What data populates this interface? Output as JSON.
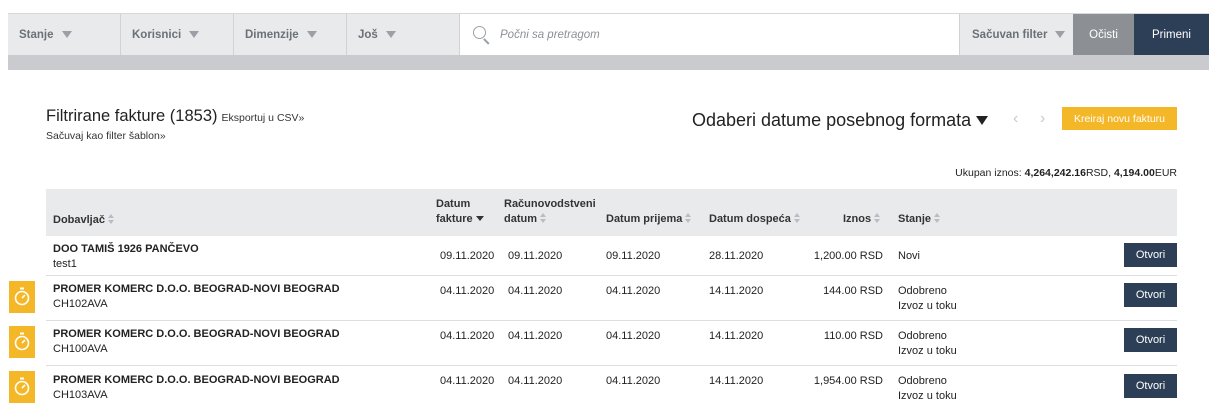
{
  "filterbar": {
    "dropdowns": [
      {
        "label": "Stanje"
      },
      {
        "label": "Korisnici"
      },
      {
        "label": "Dimenzije"
      },
      {
        "label": "Još"
      }
    ],
    "search_placeholder": "Počni sa pretragom",
    "saved_filter": "Sačuvan filter",
    "clear_label": "Očisti",
    "apply_label": "Primeni"
  },
  "header": {
    "title": "Filtrirane fakture (1853)",
    "export_label": "Eksportuj u CSV»",
    "save_filter_label": "Sačuvaj kao filter šablon»",
    "date_picker_label": "Odaberi datume posebnog formata",
    "prev_arrow": "‹",
    "next_arrow": "›",
    "create_label": "Kreiraj novu fakturu"
  },
  "totals": {
    "label": "Ukupan iznos:",
    "rsd_amount": "4,264,242.16",
    "rsd_unit": "RSD,",
    "eur_amount": "4,194.00",
    "eur_unit": "EUR"
  },
  "table": {
    "columns": {
      "supplier": "Dobavljač",
      "invoice_date_1": "Datum",
      "invoice_date_2": "fakture",
      "accounting_date_1": "Računovodstveni",
      "accounting_date_2": "datum",
      "received_date": "Datum prijema",
      "due_date": "Datum dospeća",
      "amount": "Iznos",
      "status": "Stanje"
    },
    "rows": [
      {
        "supplier": "DOO TAMIŠ 1926 PANČEVO",
        "code": "test1",
        "invoice_date": "09.11.2020",
        "accounting_date": "09.11.2020",
        "received_date": "09.11.2020",
        "due_date": "28.11.2020",
        "amount": "1,200.00 RSD",
        "status": "Novi",
        "status2": "",
        "action": "Otvori",
        "timer_icon": ""
      },
      {
        "supplier": "PROMER KOMERC D.O.O. BEOGRAD-NOVI BEOGRAD",
        "code": "CH102AVA",
        "invoice_date": "04.11.2020",
        "accounting_date": "04.11.2020",
        "received_date": "04.11.2020",
        "due_date": "14.11.2020",
        "amount": "144.00 RSD",
        "status": "Odobreno",
        "status2": "Izvoz u toku",
        "action": "Otvori",
        "timer_icon": "stopwatch-icon"
      },
      {
        "supplier": "PROMER KOMERC D.O.O. BEOGRAD-NOVI BEOGRAD",
        "code": "CH100AVA",
        "invoice_date": "04.11.2020",
        "accounting_date": "04.11.2020",
        "received_date": "04.11.2020",
        "due_date": "14.11.2020",
        "amount": "110.00 RSD",
        "status": "Odobreno",
        "status2": "Izvoz u toku",
        "action": "Otvori",
        "timer_icon": "stopwatch-icon"
      },
      {
        "supplier": "PROMER KOMERC D.O.O. BEOGRAD-NOVI BEOGRAD",
        "code": "CH103AVA",
        "invoice_date": "04.11.2020",
        "accounting_date": "04.11.2020",
        "received_date": "04.11.2020",
        "due_date": "14.11.2020",
        "amount": "1,954.00 RSD",
        "status": "Odobreno",
        "status2": "Izvoz u toku",
        "action": "Otvori",
        "timer_icon": "stopwatch-icon"
      }
    ]
  },
  "colors": {
    "primary_dark": "#2d3f56",
    "accent_yellow": "#f4b728",
    "filterbar_bg": "#e9eaeb",
    "clear_gray": "#8c9094"
  }
}
